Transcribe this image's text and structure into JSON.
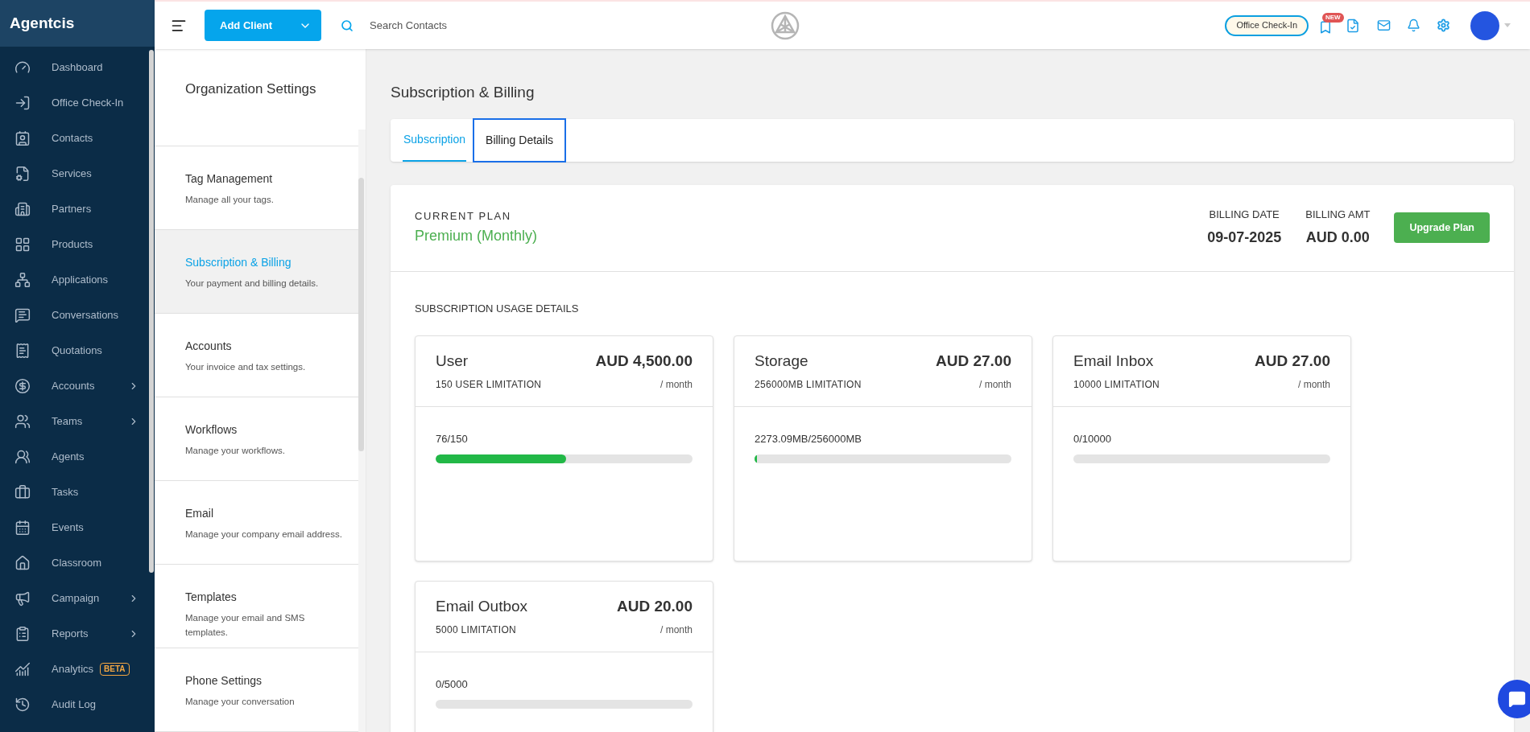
{
  "brand": "Agentcis",
  "nav": [
    {
      "label": "Dashboard",
      "expandable": false
    },
    {
      "label": "Office Check-In",
      "expandable": false
    },
    {
      "label": "Contacts",
      "expandable": false
    },
    {
      "label": "Services",
      "expandable": false
    },
    {
      "label": "Partners",
      "expandable": false
    },
    {
      "label": "Products",
      "expandable": false
    },
    {
      "label": "Applications",
      "expandable": false
    },
    {
      "label": "Conversations",
      "expandable": false
    },
    {
      "label": "Quotations",
      "expandable": false
    },
    {
      "label": "Accounts",
      "expandable": true
    },
    {
      "label": "Teams",
      "expandable": true
    },
    {
      "label": "Agents",
      "expandable": false
    },
    {
      "label": "Tasks",
      "expandable": false
    },
    {
      "label": "Events",
      "expandable": false
    },
    {
      "label": "Classroom",
      "expandable": false
    },
    {
      "label": "Campaign",
      "expandable": true
    },
    {
      "label": "Reports",
      "expandable": true
    },
    {
      "label": "Analytics",
      "expandable": false,
      "badge": "BETA"
    },
    {
      "label": "Audit Log",
      "expandable": false
    }
  ],
  "topbar": {
    "add_button": "Add Client",
    "search": {
      "placeholder": "Search Contacts"
    },
    "checkin_button": "Office Check-In",
    "new_badge": "NEW"
  },
  "settings": {
    "title": "Organization Settings",
    "items": [
      {
        "title": "Tag Management",
        "description": "Manage all your tags.",
        "selected": false
      },
      {
        "title": "Subscription & Billing",
        "description": "Your payment and billing details.",
        "selected": true
      },
      {
        "title": "Accounts",
        "description": "Your invoice and tax settings.",
        "selected": false
      },
      {
        "title": "Workflows",
        "description": "Manage your workflows.",
        "selected": false
      },
      {
        "title": "Email",
        "description": "Manage your company email address.",
        "selected": false
      },
      {
        "title": "Templates",
        "description": "Manage your email and SMS templates.",
        "selected": false
      },
      {
        "title": "Phone Settings",
        "description": "Manage your conversation",
        "selected": false
      }
    ]
  },
  "page_title": "Subscription & Billing",
  "tabs": [
    {
      "label": "Subscription",
      "selected": true,
      "focused": false
    },
    {
      "label": "Billing Details",
      "selected": false,
      "focused": true
    }
  ],
  "plan": {
    "label": "CURRENT PLAN",
    "name": "Premium (Monthly)",
    "billing_date_label": "BILLING DATE",
    "billing_date": "09-07-2025",
    "billing_amt_label": "BILLING AMT",
    "billing_amt": "AUD 0.00",
    "upgrade_button": "Upgrade Plan"
  },
  "usage_title": "SUBSCRIPTION USAGE DETAILS",
  "usage": [
    {
      "name": "User",
      "price": "AUD 4,500.00",
      "limit": "150 USER LIMITATION",
      "period": "/ month",
      "reading": "76/150",
      "level": 0.507
    },
    {
      "name": "Storage",
      "price": "AUD 27.00",
      "limit": "256000MB LIMITATION",
      "period": "/ month",
      "reading": "2273.09MB/256000MB",
      "level": 0.009
    },
    {
      "name": "Email Inbox",
      "price": "AUD 27.00",
      "limit": "10000 LIMITATION",
      "period": "/ month",
      "reading": "0/10000",
      "level": 0
    },
    {
      "name": "Email Outbox",
      "price": "AUD 20.00",
      "limit": "5000 LIMITATION",
      "period": "/ month",
      "reading": "0/5000",
      "level": 0
    }
  ]
}
